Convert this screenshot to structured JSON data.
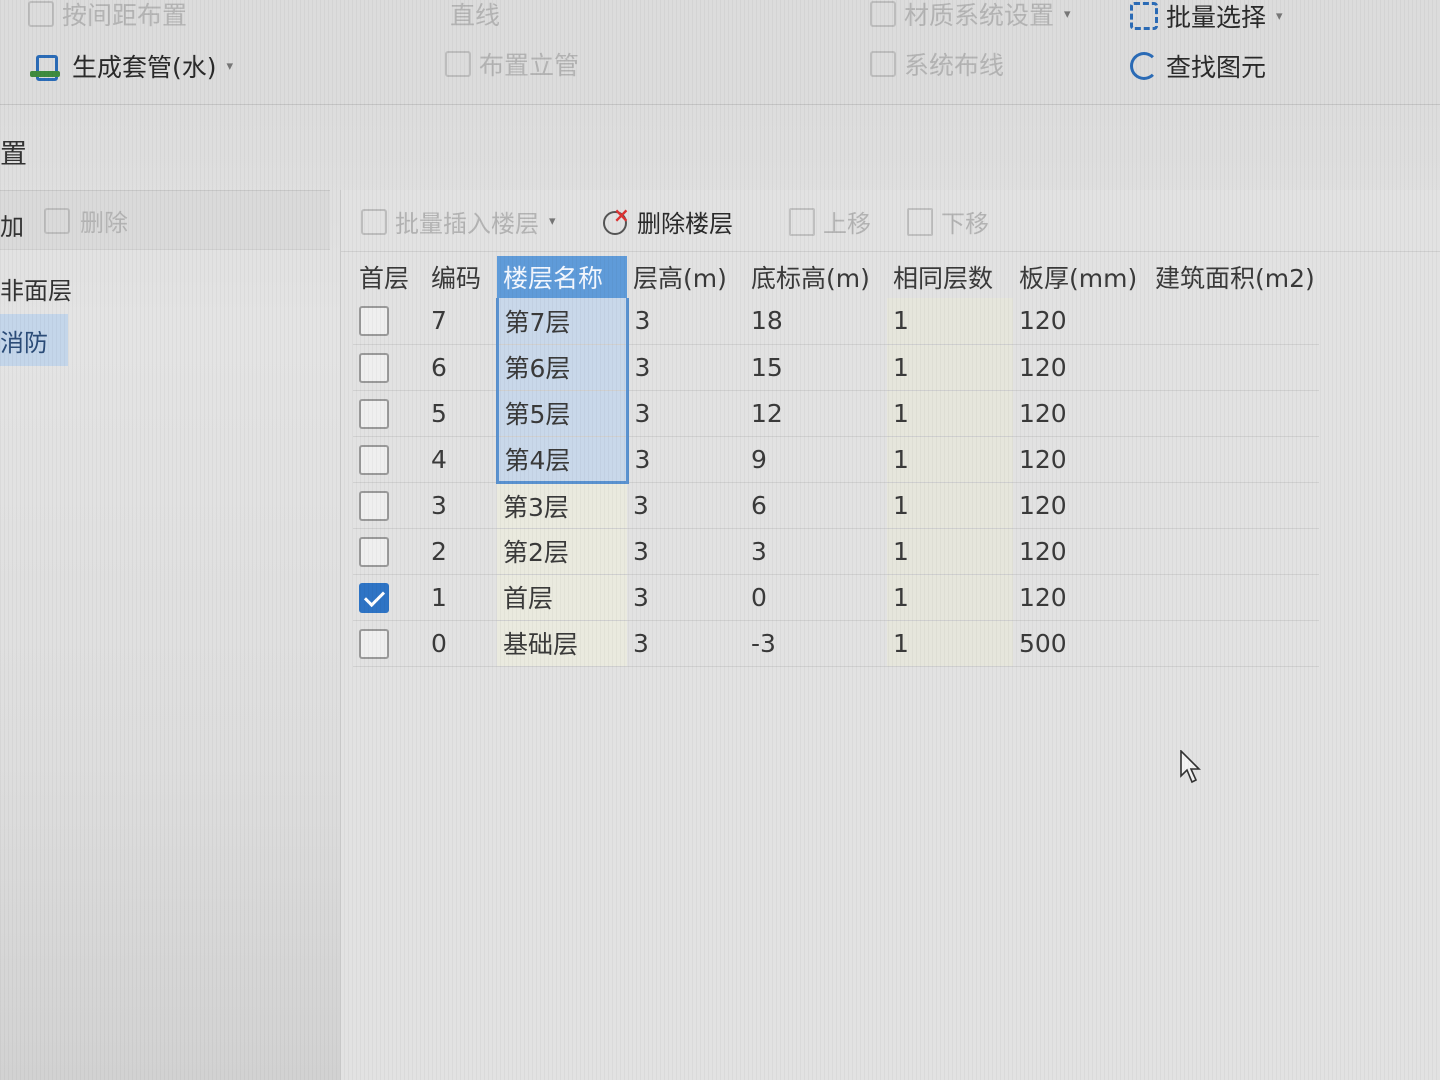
{
  "ribbon": {
    "top_left_label": "按间距布置",
    "top_mid_label": "直线",
    "top_mid2_label": "材质系统设置",
    "batch_select_label": "批量选择",
    "generate_sleeve_label": "生成套管(水)",
    "layout_rise_label": "布置立管",
    "system_pipe_label": "系统布线",
    "find_element_label": "查找图元"
  },
  "left_panel": {
    "title": "置",
    "add_label": "加",
    "delete_label": "删除",
    "items": [
      {
        "label": "非面层",
        "selected": false
      },
      {
        "label": "消防",
        "selected": true
      }
    ]
  },
  "toolbar": {
    "batch_insert_label": "批量插入楼层",
    "delete_floor_label": "删除楼层",
    "move_up_label": "上移",
    "move_down_label": "下移"
  },
  "table": {
    "headers": [
      "首层",
      "编码",
      "楼层名称",
      "层高(m)",
      "底标高(m)",
      "相同层数",
      "板厚(mm)",
      "建筑面积(m2)"
    ],
    "rows": [
      {
        "first": false,
        "code": "7",
        "name": "第7层",
        "height": "3",
        "base": "18",
        "same": "1",
        "thick": "120",
        "area": ""
      },
      {
        "first": false,
        "code": "6",
        "name": "第6层",
        "height": "3",
        "base": "15",
        "same": "1",
        "thick": "120",
        "area": ""
      },
      {
        "first": false,
        "code": "5",
        "name": "第5层",
        "height": "3",
        "base": "12",
        "same": "1",
        "thick": "120",
        "area": ""
      },
      {
        "first": false,
        "code": "4",
        "name": "第4层",
        "height": "3",
        "base": "9",
        "same": "1",
        "thick": "120",
        "area": ""
      },
      {
        "first": false,
        "code": "3",
        "name": "第3层",
        "height": "3",
        "base": "6",
        "same": "1",
        "thick": "120",
        "area": ""
      },
      {
        "first": false,
        "code": "2",
        "name": "第2层",
        "height": "3",
        "base": "3",
        "same": "1",
        "thick": "120",
        "area": ""
      },
      {
        "first": true,
        "code": "1",
        "name": "首层",
        "height": "3",
        "base": "0",
        "same": "1",
        "thick": "120",
        "area": ""
      },
      {
        "first": false,
        "code": "0",
        "name": "基础层",
        "height": "3",
        "base": "-3",
        "same": "1",
        "thick": "500",
        "area": ""
      }
    ]
  },
  "colors": {
    "accent": "#2e74c5",
    "selected_header": "#5f9bd9",
    "selected_cell": "#c9d8ea"
  }
}
